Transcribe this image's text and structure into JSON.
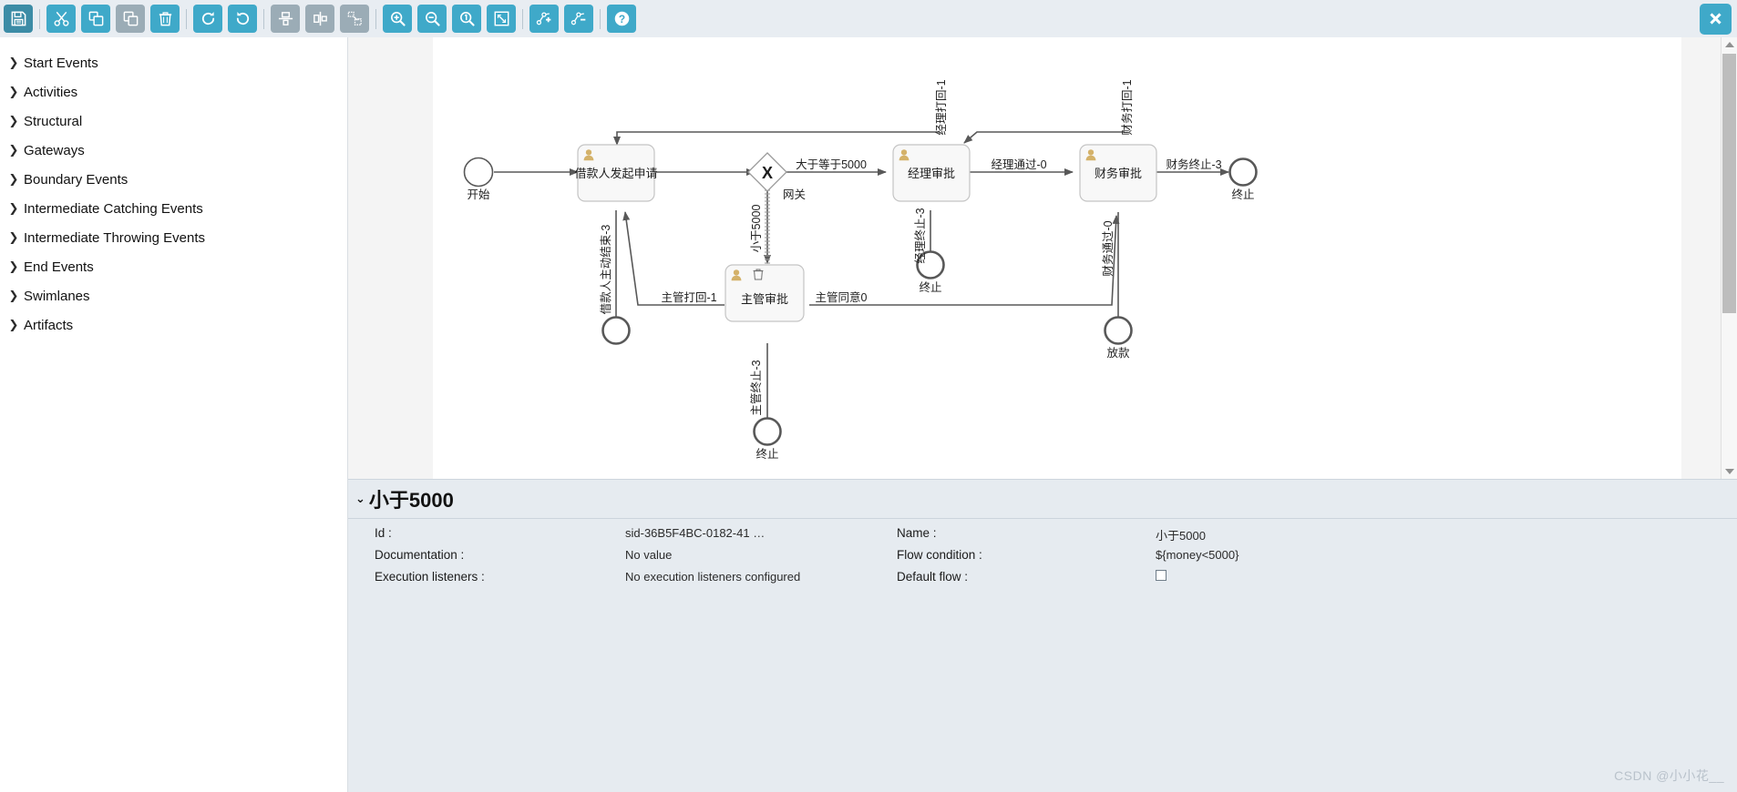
{
  "toolbar": {
    "buttons": [
      {
        "name": "save-button",
        "icon": "save-icon",
        "style": "dark",
        "title": "Save"
      },
      {
        "name": "cut-button",
        "icon": "scissors-icon",
        "style": "blue",
        "title": "Cut"
      },
      {
        "name": "copy-button",
        "icon": "copy-icon",
        "style": "blue",
        "title": "Copy"
      },
      {
        "name": "paste-button",
        "icon": "paste-icon",
        "style": "gray",
        "title": "Paste"
      },
      {
        "name": "delete-button",
        "icon": "trash-icon",
        "style": "blue",
        "title": "Delete"
      },
      {
        "name": "redo-button",
        "icon": "redo-icon",
        "style": "blue",
        "title": "Redo"
      },
      {
        "name": "undo-button",
        "icon": "undo-icon",
        "style": "blue",
        "title": "Undo"
      },
      {
        "name": "align-vertical-button",
        "icon": "align-vertical-icon",
        "style": "gray",
        "title": "Align vertical"
      },
      {
        "name": "align-horizontal-button",
        "icon": "align-horizontal-icon",
        "style": "gray",
        "title": "Align horizontal"
      },
      {
        "name": "same-size-button",
        "icon": "same-size-icon",
        "style": "gray",
        "title": "Same size"
      },
      {
        "name": "zoom-in-button",
        "icon": "zoom-in-icon",
        "style": "blue",
        "title": "Zoom in"
      },
      {
        "name": "zoom-out-button",
        "icon": "zoom-out-icon",
        "style": "blue",
        "title": "Zoom out"
      },
      {
        "name": "zoom-actual-button",
        "icon": "zoom-actual-icon",
        "style": "blue",
        "title": "Zoom 1:1"
      },
      {
        "name": "zoom-fit-button",
        "icon": "zoom-fit-icon",
        "style": "blue",
        "title": "Zoom to fit"
      },
      {
        "name": "add-bendpoint-button",
        "icon": "add-bendpoint-icon",
        "style": "blue",
        "title": "Add bendpoint"
      },
      {
        "name": "remove-bendpoint-button",
        "icon": "remove-bendpoint-icon",
        "style": "blue",
        "title": "Remove bendpoint"
      },
      {
        "name": "help-button",
        "icon": "help-icon",
        "style": "blue",
        "title": "Help"
      }
    ],
    "close_label": "✖"
  },
  "palette": {
    "items": [
      {
        "label": "Start Events",
        "name": "palette-group-start-events"
      },
      {
        "label": "Activities",
        "name": "palette-group-activities"
      },
      {
        "label": "Structural",
        "name": "palette-group-structural"
      },
      {
        "label": "Gateways",
        "name": "palette-group-gateways"
      },
      {
        "label": "Boundary Events",
        "name": "palette-group-boundary-events"
      },
      {
        "label": "Intermediate Catching Events",
        "name": "palette-group-intermediate-catching-events"
      },
      {
        "label": "Intermediate Throwing Events",
        "name": "palette-group-intermediate-throwing-events"
      },
      {
        "label": "End Events",
        "name": "palette-group-end-events"
      },
      {
        "label": "Swimlanes",
        "name": "palette-group-swimlanes"
      },
      {
        "label": "Artifacts",
        "name": "palette-group-artifacts"
      }
    ],
    "chevron": "❯"
  },
  "diagram": {
    "nodes": {
      "start_event": {
        "label": "开始",
        "type": "start-event"
      },
      "task_applicant": {
        "label": "借款人发起申请",
        "type": "user-task"
      },
      "gateway": {
        "label": "网关",
        "type": "exclusive-gateway",
        "marker": "X"
      },
      "task_supervisor": {
        "label": "主管审批",
        "type": "user-task",
        "selected": true
      },
      "task_manager": {
        "label": "经理审批",
        "type": "user-task"
      },
      "task_finance": {
        "label": "财务审批",
        "type": "user-task"
      },
      "end_applicant_cancel": {
        "label": "",
        "type": "end-event"
      },
      "end_supervisor_stop": {
        "label": "终止",
        "type": "end-event"
      },
      "end_manager_stop": {
        "label": "终止",
        "type": "end-event"
      },
      "end_finance_stop": {
        "label": "终止",
        "type": "end-event"
      },
      "end_loan": {
        "label": "放款",
        "type": "end-event"
      }
    },
    "flows": {
      "gateway_ge": "大于等于5000",
      "gateway_lt": "小于5000",
      "applicant_cancel": "借款人主动结束-3",
      "supervisor_reject": "主管打回-1",
      "supervisor_agree": "主管同意0",
      "supervisor_stop": "主管终止-3",
      "manager_reject": "经理打回-1",
      "manager_pass": "经理通过-0",
      "manager_stop": "经理终止-3",
      "finance_reject": "财务打回-1",
      "finance_pass": "财务通过-0",
      "finance_stop": "财务终止-3"
    }
  },
  "properties": {
    "title": "小于5000",
    "chevron": "⌄",
    "left": [
      {
        "label": "Id :",
        "value": "sid-36B5F4BC-0182-41 …",
        "name": "property-id"
      },
      {
        "label": "Documentation :",
        "value": "No value",
        "name": "property-documentation"
      },
      {
        "label": "Execution listeners :",
        "value": "No execution listeners configured",
        "name": "property-execution-listeners"
      }
    ],
    "right": [
      {
        "label": "Name :",
        "value": "小于5000",
        "name": "property-name",
        "type": "text"
      },
      {
        "label": "Flow condition :",
        "value": "${money<5000}",
        "name": "property-flow-condition",
        "type": "text"
      },
      {
        "label": "Default flow :",
        "value": "",
        "name": "property-default-flow",
        "type": "checkbox"
      }
    ]
  },
  "watermark": {
    "text": "CSDN @小小花__"
  },
  "colors": {
    "toolbar_blue": "#3fa9c9",
    "toolbar_dark": "#3c8ca6",
    "toolbar_gray": "#9bacb6",
    "toolbar_bg": "#e8edf2",
    "panel_bg": "#e6ebf0",
    "canvas_bg": "#f4f4f4",
    "node_fill": "#f8f8f8",
    "node_stroke": "#bfbfbf",
    "flow_stroke": "#585858",
    "user_icon": "#d4b26a"
  }
}
